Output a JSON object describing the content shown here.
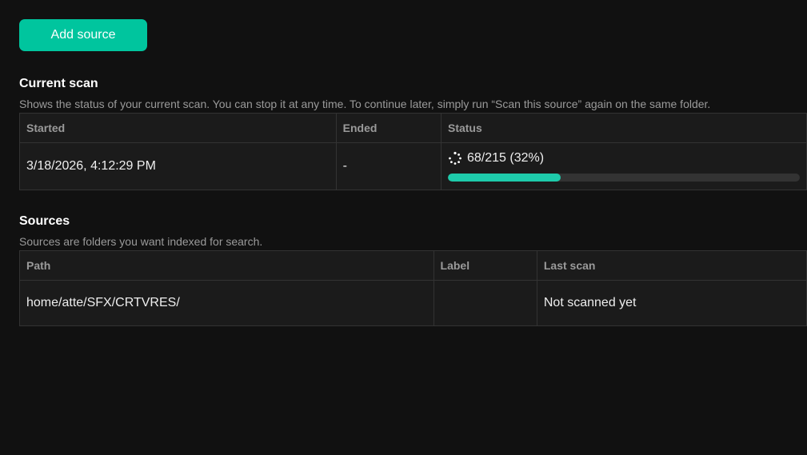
{
  "add_source_label": "Add source",
  "current_scan": {
    "title": "Current scan",
    "description": "Shows the status of your current scan. You can stop it at any time. To continue later, simply run “Scan this source” again on the same folder.",
    "headers": [
      "Started",
      "Ended",
      "Status"
    ],
    "row": {
      "started": "3/18/2026, 4:12:29 PM",
      "ended": "-",
      "status": "68/215 (32%)",
      "progress_percent": 32
    },
    "accent": "#00c59e"
  },
  "sources": {
    "title": "Sources",
    "description": "Sources are folders you want indexed for search.",
    "headers": [
      "Path",
      "Label",
      "Last scan"
    ],
    "rows": [
      {
        "path": "home/atte/SFX/CRTVRES/",
        "label": "",
        "last_scan": "Not scanned yet"
      }
    ]
  }
}
